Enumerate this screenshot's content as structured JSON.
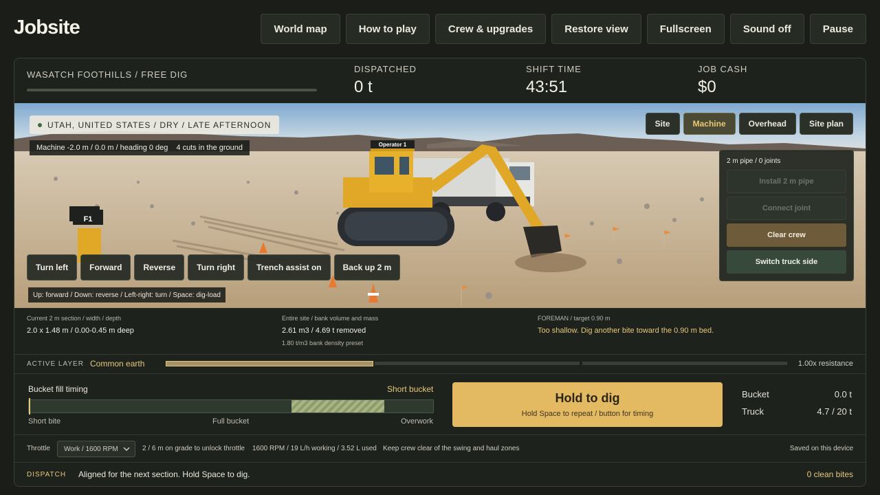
{
  "app": {
    "title": "Jobsite",
    "nav": [
      "World map",
      "How to play",
      "Crew & upgrades",
      "Restore view",
      "Fullscreen",
      "Sound off",
      "Pause"
    ]
  },
  "stats": {
    "site": "WASATCH FOOTHILLS / FREE DIG",
    "dispatched_label": "DISPATCHED",
    "dispatched_value": "0 t",
    "shift_label": "SHIFT TIME",
    "shift_value": "43:51",
    "cash_label": "JOB CASH",
    "cash_value": "$0"
  },
  "scene": {
    "location": "UTAH, UNITED STATES / DRY / LATE AFTERNOON",
    "machine_pos": "Machine -2.0 m / 0.0 m / heading 0 deg",
    "cuts": "4 cuts in the ground",
    "operator_tag": "Operator 1",
    "crew_tag": "F1",
    "view_tabs": [
      "Site",
      "Machine",
      "Overhead",
      "Site plan"
    ],
    "active_view": "Machine",
    "pipe": {
      "header": "2 m pipe / 0 joints",
      "install": "Install 2 m pipe",
      "connect": "Connect joint",
      "clear": "Clear crew",
      "switch": "Switch truck side"
    },
    "controls": [
      "Turn left",
      "Forward",
      "Reverse",
      "Turn right",
      "Trench assist on",
      "Back up 2 m"
    ],
    "keys": "Up: forward / Down: reverse / Left-right: turn / Space: dig-load"
  },
  "details": {
    "section_label": "Current 2 m section / width / depth",
    "section_value": "2.0 x 1.48 m / 0.00-0.45 m deep",
    "volume_label": "Entire site / bank volume and mass",
    "volume_value": "2.61 m3 / 4.69 t removed",
    "density": "1.80 t/m3 bank density preset",
    "foreman_label": "FOREMAN / target 0.90 m",
    "foreman_msg": "Too shallow. Dig another bite toward the 0.90 m bed."
  },
  "layer": {
    "label": "ACTIVE LAYER",
    "name": "Common earth",
    "resistance": "1.00x resistance"
  },
  "dig": {
    "timing_label": "Bucket fill timing",
    "status": "Short bucket",
    "scale": [
      "Short bite",
      "Full bucket",
      "Overwork"
    ],
    "marker_fraction": 0.0,
    "zone_fraction": [
      0.65,
      0.88
    ],
    "hold_title": "Hold to dig",
    "hold_sub": "Hold Space to repeat / button for timing",
    "bucket_label": "Bucket",
    "bucket_value": "0.0 t",
    "truck_label": "Truck",
    "truck_value": "4.7 / 20 t"
  },
  "throttle": {
    "label": "Throttle",
    "selected": "Work / 1600 RPM",
    "grade": "2 / 6 m on grade to unlock throttle",
    "engine": "1600 RPM / 19 L/h working / 3.52 L used",
    "safety": "Keep crew clear of the swing and haul zones",
    "saved": "Saved on this device"
  },
  "dispatch": {
    "label": "DISPATCH",
    "message": "Aligned for the next section. Hold Space to dig.",
    "bites": "0 clean bites"
  },
  "colors": {
    "accent": "#e3b961",
    "panel": "#1d221c",
    "machine": "#e0a826"
  }
}
